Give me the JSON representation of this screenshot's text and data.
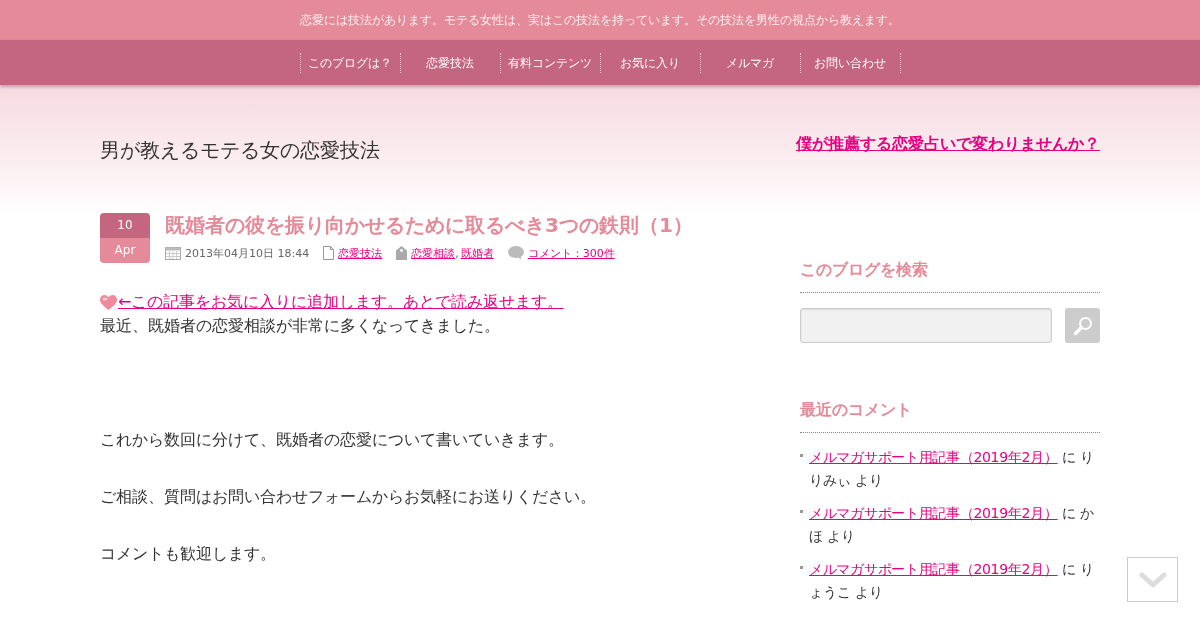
{
  "top_bar": {
    "tagline": "恋愛には技法があります。モテる女性は、実はこの技法を持っています。その技法を男性の視点から教えます。"
  },
  "nav": {
    "items": [
      "このブログは？",
      "恋愛技法",
      "有料コンテンツ",
      "お気に入り",
      "メルマガ",
      "お問い合わせ"
    ]
  },
  "header": {
    "site_title": "男が教えるモテる女の恋愛技法",
    "promo_link": "僕が推薦する恋愛占いで変わりませんか？"
  },
  "post": {
    "date": {
      "day": "10",
      "month": "Apr"
    },
    "title": "既婚者の彼を振り向かせるために取るべき3つの鉄則（1）",
    "meta": {
      "datetime": "2013年04月10日 18:44",
      "category": "恋愛技法",
      "tags": [
        "恋愛相談",
        "既婚者"
      ],
      "tag_separator": ",",
      "comments": "コメント：300件"
    },
    "favorite_link": "←この記事をお気に入りに追加します。あとで読み返せます。",
    "paragraphs": [
      "最近、既婚者の恋愛相談が非常に多くなってきました。",
      "これから数回に分けて、既婚者の恋愛について書いていきます。",
      "ご相談、質問はお問い合わせフォームからお気軽にお送りください。",
      "コメントも歓迎します。"
    ]
  },
  "sidebar": {
    "search": {
      "heading": "このブログを検索"
    },
    "recent_comments": {
      "heading": "最近のコメント",
      "items": [
        {
          "link": "メルマガサポート用記事（2019年2月）",
          "text": "に りりみぃ より"
        },
        {
          "link": "メルマガサポート用記事（2019年2月）",
          "text": "に かほ より"
        },
        {
          "link": "メルマガサポート用記事（2019年2月）",
          "text": "に りょうこ より"
        }
      ]
    }
  }
}
